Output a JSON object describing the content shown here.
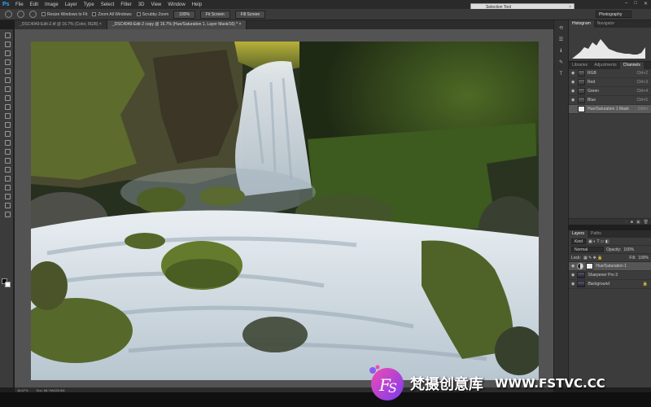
{
  "app": {
    "logo": "Ps"
  },
  "menu": [
    "File",
    "Edit",
    "Image",
    "Layer",
    "Type",
    "Select",
    "Filter",
    "3D",
    "View",
    "Window",
    "Help"
  ],
  "search_panel": {
    "title": "Selection Tool"
  },
  "window_controls": [
    "–",
    "□",
    "✕"
  ],
  "options_bar": {
    "resize_label": "Resize Windows to Fit",
    "zoom_all_label": "Zoom All Windows",
    "scrubby_label": "Scrubby Zoom",
    "percent_btn": "100%",
    "fit_btn": "Fit Screen",
    "fill_btn": "Fill Screen",
    "workspace": "Photography"
  },
  "tabs": [
    {
      "label": "_DSC4049-Edit-2.tif @ 16.7% (Color, 8G/8) ×",
      "active": false
    },
    {
      "label": "_DSC4049-Edit-2 copy @ 16.7% (Hue/Saturation 1, Layer Mask/16) * ×",
      "active": true
    }
  ],
  "status_bar": {
    "zoom": "16.67%",
    "doc": "Doc: 68.7M/435.5M"
  },
  "histogram_panel": {
    "tabs": [
      "Histogram",
      "Navigator"
    ]
  },
  "channels_panel": {
    "tabs": [
      "Libraries",
      "Adjustments",
      "Channels"
    ],
    "rows": [
      {
        "label": "RGB",
        "shortcut": "Ctrl+2"
      },
      {
        "label": "Red",
        "shortcut": "Ctrl+3"
      },
      {
        "label": "Green",
        "shortcut": "Ctrl+4"
      },
      {
        "label": "Blue",
        "shortcut": "Ctrl+5"
      },
      {
        "label": "Hue/Saturation 1 Mask",
        "shortcut": "Ctrl+\\"
      }
    ]
  },
  "layers_panel": {
    "tabs": [
      "Layers",
      "Paths"
    ],
    "kind": "Kind",
    "blend_mode": "Normal",
    "opacity_label": "Opacity:",
    "opacity": "100%",
    "lock_label": "Lock:",
    "fill_label": "Fill:",
    "fill": "100%",
    "layers": [
      {
        "name": "Hue/Saturation 1"
      },
      {
        "name": "Sharpener Pro 3"
      },
      {
        "name": "Background"
      }
    ]
  },
  "watermark": {
    "text": "梵摄创意库",
    "url": "WWW.FSTVC.CC"
  }
}
